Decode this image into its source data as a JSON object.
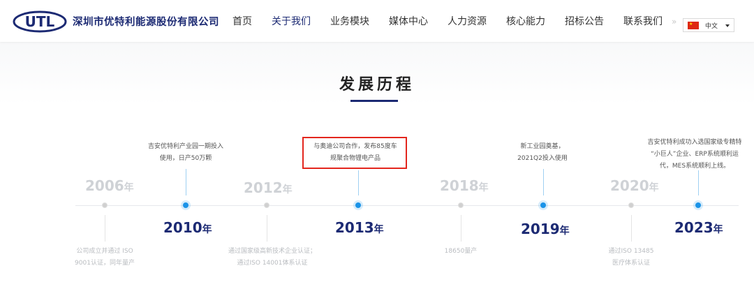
{
  "header": {
    "logo_text": "UTL",
    "company_name": "深圳市优特利能源股份有限公司",
    "nav": [
      {
        "label": "首页"
      },
      {
        "label": "关于我们"
      },
      {
        "label": "业务模块"
      },
      {
        "label": "媒体中心"
      },
      {
        "label": "人力资源"
      },
      {
        "label": "核心能力"
      },
      {
        "label": "招标公告"
      },
      {
        "label": "联系我们"
      }
    ],
    "nav_separator": "»",
    "language": {
      "flag_icon": "china-flag-icon",
      "selected": "中文"
    }
  },
  "section": {
    "title": "发展历程"
  },
  "timeline": {
    "unit": "年",
    "entries": [
      {
        "year": "2006",
        "active": false,
        "desc": [
          "公司成立并通过 ISO",
          "9001认证，同年量产"
        ]
      },
      {
        "year": "2010",
        "active": true,
        "desc": [
          "吉安优特利产业园一期投入",
          "使用，日产50万颗"
        ]
      },
      {
        "year": "2012",
        "active": false,
        "desc": [
          "通过国家级高新技术企业认证；",
          "通过ISO 14001体系认证"
        ]
      },
      {
        "year": "2013",
        "active": true,
        "desc": [
          "与奥迪公司合作，发布85度车",
          "规聚合物锂电产品"
        ]
      },
      {
        "year": "2018",
        "active": false,
        "desc": [
          "18650量产"
        ]
      },
      {
        "year": "2019",
        "active": true,
        "desc": [
          "新工业园奠基，",
          "2021Q2投入使用"
        ]
      },
      {
        "year": "2020",
        "active": false,
        "desc": [
          "通过ISO 13485",
          "医疗体系认证"
        ]
      },
      {
        "year": "2023",
        "active": true,
        "desc": [
          "吉安优特利成功入选国家级专精特",
          "“小巨人”企业、ERP系统顺利运",
          "代，MES系统顺利上线。"
        ]
      }
    ]
  },
  "colors": {
    "brand": "#1c2a73",
    "accent": "#1a93e8",
    "highlight": "#e3261d"
  }
}
